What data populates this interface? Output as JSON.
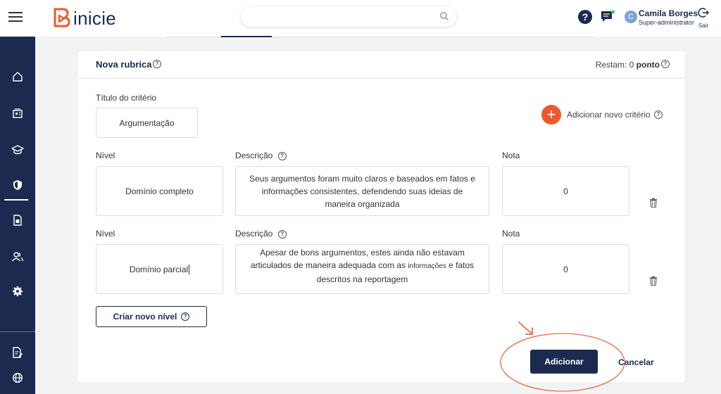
{
  "app": {
    "logo_text": "inicie"
  },
  "header": {
    "search": {
      "placeholder": ""
    },
    "user": {
      "initial": "C",
      "name": "Camila Borges",
      "role": "Super-administrator"
    },
    "logout_label": "Sair"
  },
  "sidebar": {
    "items": [
      {
        "icon": "home-icon"
      },
      {
        "icon": "dashboard-icon"
      },
      {
        "icon": "graduation-cap-icon",
        "active": true
      },
      {
        "icon": "shield-icon"
      },
      {
        "icon": "document-icon"
      },
      {
        "icon": "users-icon"
      },
      {
        "icon": "gear-icon"
      },
      {
        "icon": "edit-document-icon"
      },
      {
        "icon": "globe-icon"
      }
    ]
  },
  "rubric": {
    "title": "Nova rubrica",
    "remaining_prefix": "Restam: 0",
    "remaining_unit": "ponto",
    "criterion_title_label": "Título do critério",
    "criterion_title_value": "Argumentação",
    "add_criterion_label": "Adicionar novo critério",
    "level_label": "Nível",
    "description_label": "Descrição",
    "grade_label": "Nota",
    "levels": [
      {
        "level": "Domínio completo",
        "description": "Seus argumentos foram muito claros e baseados em fatos e informações consistentes, defendendo suas ideias de maneira organizada",
        "grade": "0"
      },
      {
        "level": "Domínio parcial",
        "description_part1": "Apesar de bons argumentos, estes ainda não estavam articulados de maneira adequada com as",
        "description_part2": "informações",
        "description_part3": "e fatos descritos na reportagem",
        "grade": "0"
      }
    ],
    "new_level_button": "Criar novo nível",
    "add_button": "Adicionar",
    "cancel_button": "Cancelar"
  },
  "colors": {
    "navy": "#1b2a4e",
    "accent": "#ea5a2f"
  }
}
